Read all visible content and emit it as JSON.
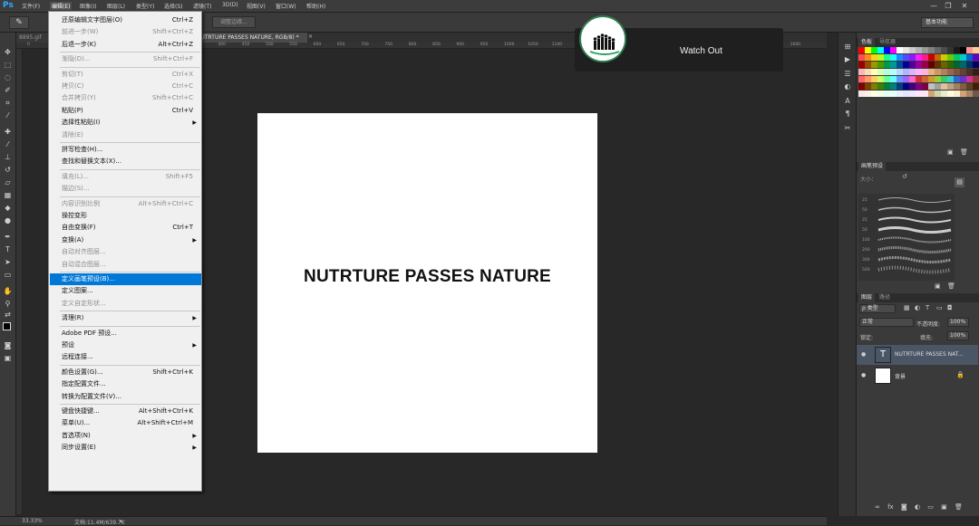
{
  "app": {
    "logo": "Ps",
    "menus": [
      "文件(F)",
      "编辑(E)",
      "图像(I)",
      "图层(L)",
      "类型(Y)",
      "选择(S)",
      "滤镜(T)",
      "3D(D)",
      "视图(V)",
      "窗口(W)",
      "帮助(H)"
    ],
    "active_menu_index": 1,
    "window_controls": {
      "minimize": "—",
      "restore": "❐",
      "close": "✕"
    }
  },
  "options_bar": {
    "refine_button": "调整边缘...",
    "workspace": "基本功能"
  },
  "tabs": [
    {
      "label": "8895.gif",
      "active": false
    },
    {
      "label": "NUTRTURE PASSES NATURE, RGB/8) *",
      "active": true
    }
  ],
  "ruler_ticks": [
    "0",
    "50",
    "100",
    "150",
    "200",
    "250",
    "300",
    "350",
    "400",
    "450",
    "500",
    "550",
    "600",
    "650",
    "700",
    "750",
    "800",
    "850",
    "900",
    "950",
    "1000",
    "1050",
    "1100",
    "1150",
    "1200",
    "1250",
    "1300",
    "1350",
    "1400",
    "1450",
    "1500",
    "1550",
    "1600"
  ],
  "canvas": {
    "text": "NUTRTURE PASSES NATURE",
    "background": "#ffffff"
  },
  "edit_menu": {
    "items": [
      {
        "label": "还原编辑文字图层(O)",
        "shortcut": "Ctrl+Z",
        "disabled": false
      },
      {
        "label": "前进一步(W)",
        "shortcut": "Shift+Ctrl+Z",
        "disabled": true
      },
      {
        "label": "后退一步(K)",
        "shortcut": "Alt+Ctrl+Z",
        "disabled": false
      },
      {
        "sep": true
      },
      {
        "label": "渐隐(D)...",
        "shortcut": "Shift+Ctrl+F",
        "disabled": true
      },
      {
        "sep": true
      },
      {
        "label": "剪切(T)",
        "shortcut": "Ctrl+X",
        "disabled": true
      },
      {
        "label": "拷贝(C)",
        "shortcut": "Ctrl+C",
        "disabled": true
      },
      {
        "label": "合并拷贝(Y)",
        "shortcut": "Shift+Ctrl+C",
        "disabled": true
      },
      {
        "label": "粘贴(P)",
        "shortcut": "Ctrl+V",
        "disabled": false
      },
      {
        "label": "选择性粘贴(I)",
        "shortcut": "",
        "disabled": false,
        "submenu": true
      },
      {
        "label": "清除(E)",
        "shortcut": "",
        "disabled": true
      },
      {
        "sep": true
      },
      {
        "label": "拼写检查(H)...",
        "shortcut": "",
        "disabled": false
      },
      {
        "label": "查找和替换文本(X)...",
        "shortcut": "",
        "disabled": false
      },
      {
        "sep": true
      },
      {
        "label": "填充(L)...",
        "shortcut": "Shift+F5",
        "disabled": true
      },
      {
        "label": "描边(S)...",
        "shortcut": "",
        "disabled": true
      },
      {
        "sep": true
      },
      {
        "label": "内容识别比例",
        "shortcut": "Alt+Shift+Ctrl+C",
        "disabled": true
      },
      {
        "label": "操控变形",
        "shortcut": "",
        "disabled": false
      },
      {
        "label": "自由变换(F)",
        "shortcut": "Ctrl+T",
        "disabled": false
      },
      {
        "label": "变换(A)",
        "shortcut": "",
        "disabled": false,
        "submenu": true
      },
      {
        "label": "自动对齐图层...",
        "shortcut": "",
        "disabled": true
      },
      {
        "label": "自动混合图层...",
        "shortcut": "",
        "disabled": true
      },
      {
        "sep": true
      },
      {
        "label": "定义画笔预设(B)...",
        "shortcut": "",
        "disabled": false,
        "highlighted": true
      },
      {
        "label": "定义图案...",
        "shortcut": "",
        "disabled": false
      },
      {
        "label": "定义自定形状...",
        "shortcut": "",
        "disabled": true
      },
      {
        "sep": true
      },
      {
        "label": "清理(R)",
        "shortcut": "",
        "disabled": false,
        "submenu": true
      },
      {
        "sep": true
      },
      {
        "label": "Adobe PDF 预设...",
        "shortcut": "",
        "disabled": false
      },
      {
        "label": "预设",
        "shortcut": "",
        "disabled": false,
        "submenu": true
      },
      {
        "label": "远程连接...",
        "shortcut": "",
        "disabled": false
      },
      {
        "sep": true
      },
      {
        "label": "颜色设置(G)...",
        "shortcut": "Shift+Ctrl+K",
        "disabled": false
      },
      {
        "label": "指定配置文件...",
        "shortcut": "",
        "disabled": false
      },
      {
        "label": "转换为配置文件(V)...",
        "shortcut": "",
        "disabled": false
      },
      {
        "sep": true
      },
      {
        "label": "键盘快捷键...",
        "shortcut": "Alt+Shift+Ctrl+K",
        "disabled": false
      },
      {
        "label": "菜单(U)...",
        "shortcut": "Alt+Shift+Ctrl+M",
        "disabled": false
      },
      {
        "label": "首选项(N)",
        "shortcut": "",
        "disabled": false,
        "submenu": true
      },
      {
        "label": "同步设置(E)",
        "shortcut": "",
        "disabled": false,
        "submenu": true
      }
    ]
  },
  "notification": {
    "title": "Watch Out"
  },
  "panels": {
    "swatches_tabs": [
      "色板",
      "导航器"
    ],
    "brush_tabs": [
      "画笔预设"
    ],
    "brush_size_label": "大小：",
    "brush_sizes": [
      "25",
      "50",
      "25",
      "50",
      "100",
      "200",
      "300",
      "500",
      "1000"
    ],
    "layers_tabs": [
      "图层",
      "路径"
    ],
    "layers_filter": "ρ 类型",
    "blend_mode": "正常",
    "opacity_label": "不透明度:",
    "opacity_value": "100%",
    "lock_label": "锁定:",
    "fill_label": "填充:",
    "fill_value": "100%",
    "layers": [
      {
        "name": "NUTRTURE PASSES NAT...",
        "type": "text",
        "selected": true
      },
      {
        "name": "背景",
        "type": "fill",
        "selected": false
      }
    ]
  },
  "status": {
    "zoom": "33.33%",
    "doc_info": "文档:11.4M/639.7K"
  }
}
